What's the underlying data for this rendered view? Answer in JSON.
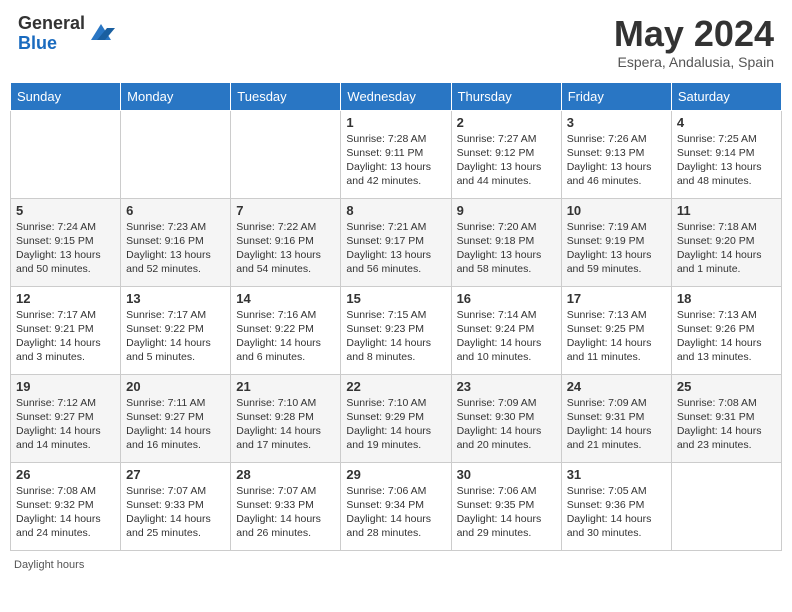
{
  "logo": {
    "general": "General",
    "blue": "Blue"
  },
  "title": "May 2024",
  "location": "Espera, Andalusia, Spain",
  "days_of_week": [
    "Sunday",
    "Monday",
    "Tuesday",
    "Wednesday",
    "Thursday",
    "Friday",
    "Saturday"
  ],
  "weeks": [
    [
      {
        "day": "",
        "info": ""
      },
      {
        "day": "",
        "info": ""
      },
      {
        "day": "",
        "info": ""
      },
      {
        "day": "1",
        "info": "Sunrise: 7:28 AM\nSunset: 9:11 PM\nDaylight: 13 hours\nand 42 minutes."
      },
      {
        "day": "2",
        "info": "Sunrise: 7:27 AM\nSunset: 9:12 PM\nDaylight: 13 hours\nand 44 minutes."
      },
      {
        "day": "3",
        "info": "Sunrise: 7:26 AM\nSunset: 9:13 PM\nDaylight: 13 hours\nand 46 minutes."
      },
      {
        "day": "4",
        "info": "Sunrise: 7:25 AM\nSunset: 9:14 PM\nDaylight: 13 hours\nand 48 minutes."
      }
    ],
    [
      {
        "day": "5",
        "info": "Sunrise: 7:24 AM\nSunset: 9:15 PM\nDaylight: 13 hours\nand 50 minutes."
      },
      {
        "day": "6",
        "info": "Sunrise: 7:23 AM\nSunset: 9:16 PM\nDaylight: 13 hours\nand 52 minutes."
      },
      {
        "day": "7",
        "info": "Sunrise: 7:22 AM\nSunset: 9:16 PM\nDaylight: 13 hours\nand 54 minutes."
      },
      {
        "day": "8",
        "info": "Sunrise: 7:21 AM\nSunset: 9:17 PM\nDaylight: 13 hours\nand 56 minutes."
      },
      {
        "day": "9",
        "info": "Sunrise: 7:20 AM\nSunset: 9:18 PM\nDaylight: 13 hours\nand 58 minutes."
      },
      {
        "day": "10",
        "info": "Sunrise: 7:19 AM\nSunset: 9:19 PM\nDaylight: 13 hours\nand 59 minutes."
      },
      {
        "day": "11",
        "info": "Sunrise: 7:18 AM\nSunset: 9:20 PM\nDaylight: 14 hours\nand 1 minute."
      }
    ],
    [
      {
        "day": "12",
        "info": "Sunrise: 7:17 AM\nSunset: 9:21 PM\nDaylight: 14 hours\nand 3 minutes."
      },
      {
        "day": "13",
        "info": "Sunrise: 7:17 AM\nSunset: 9:22 PM\nDaylight: 14 hours\nand 5 minutes."
      },
      {
        "day": "14",
        "info": "Sunrise: 7:16 AM\nSunset: 9:22 PM\nDaylight: 14 hours\nand 6 minutes."
      },
      {
        "day": "15",
        "info": "Sunrise: 7:15 AM\nSunset: 9:23 PM\nDaylight: 14 hours\nand 8 minutes."
      },
      {
        "day": "16",
        "info": "Sunrise: 7:14 AM\nSunset: 9:24 PM\nDaylight: 14 hours\nand 10 minutes."
      },
      {
        "day": "17",
        "info": "Sunrise: 7:13 AM\nSunset: 9:25 PM\nDaylight: 14 hours\nand 11 minutes."
      },
      {
        "day": "18",
        "info": "Sunrise: 7:13 AM\nSunset: 9:26 PM\nDaylight: 14 hours\nand 13 minutes."
      }
    ],
    [
      {
        "day": "19",
        "info": "Sunrise: 7:12 AM\nSunset: 9:27 PM\nDaylight: 14 hours\nand 14 minutes."
      },
      {
        "day": "20",
        "info": "Sunrise: 7:11 AM\nSunset: 9:27 PM\nDaylight: 14 hours\nand 16 minutes."
      },
      {
        "day": "21",
        "info": "Sunrise: 7:10 AM\nSunset: 9:28 PM\nDaylight: 14 hours\nand 17 minutes."
      },
      {
        "day": "22",
        "info": "Sunrise: 7:10 AM\nSunset: 9:29 PM\nDaylight: 14 hours\nand 19 minutes."
      },
      {
        "day": "23",
        "info": "Sunrise: 7:09 AM\nSunset: 9:30 PM\nDaylight: 14 hours\nand 20 minutes."
      },
      {
        "day": "24",
        "info": "Sunrise: 7:09 AM\nSunset: 9:31 PM\nDaylight: 14 hours\nand 21 minutes."
      },
      {
        "day": "25",
        "info": "Sunrise: 7:08 AM\nSunset: 9:31 PM\nDaylight: 14 hours\nand 23 minutes."
      }
    ],
    [
      {
        "day": "26",
        "info": "Sunrise: 7:08 AM\nSunset: 9:32 PM\nDaylight: 14 hours\nand 24 minutes."
      },
      {
        "day": "27",
        "info": "Sunrise: 7:07 AM\nSunset: 9:33 PM\nDaylight: 14 hours\nand 25 minutes."
      },
      {
        "day": "28",
        "info": "Sunrise: 7:07 AM\nSunset: 9:33 PM\nDaylight: 14 hours\nand 26 minutes."
      },
      {
        "day": "29",
        "info": "Sunrise: 7:06 AM\nSunset: 9:34 PM\nDaylight: 14 hours\nand 28 minutes."
      },
      {
        "day": "30",
        "info": "Sunrise: 7:06 AM\nSunset: 9:35 PM\nDaylight: 14 hours\nand 29 minutes."
      },
      {
        "day": "31",
        "info": "Sunrise: 7:05 AM\nSunset: 9:36 PM\nDaylight: 14 hours\nand 30 minutes."
      },
      {
        "day": "",
        "info": ""
      }
    ]
  ],
  "footer": "Daylight hours"
}
